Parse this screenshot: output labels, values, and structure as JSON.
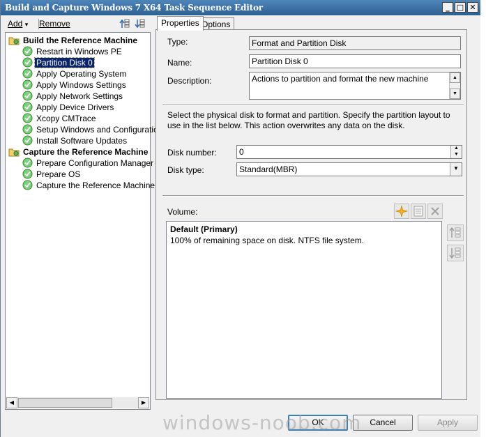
{
  "window": {
    "title": "Build and Capture Windows 7 X64 Task Sequence Editor"
  },
  "window_controls": {
    "minimize": "_",
    "maximize": "□",
    "close": "✕"
  },
  "toolbar": {
    "add_label": "Add",
    "add_caret": "▾",
    "remove_label": "Remove"
  },
  "tree": {
    "groups": [
      {
        "label": "Build the Reference Machine",
        "items": [
          "Restart in Windows PE",
          "Partition Disk 0",
          "Apply Operating System",
          "Apply Windows Settings",
          "Apply Network Settings",
          "Apply Device Drivers",
          "Xcopy CMTrace",
          "Setup Windows and Configuration",
          "Install Software Updates"
        ]
      },
      {
        "label": "Capture the Reference Machine",
        "items": [
          "Prepare Configuration Manager Cli",
          "Prepare OS",
          "Capture the Reference Machine"
        ]
      }
    ],
    "selected_item": "Partition Disk 0"
  },
  "tabs": {
    "properties": "Properties",
    "options": "Options"
  },
  "properties": {
    "type_label": "Type:",
    "type_value": "Format and Partition Disk",
    "name_label": "Name:",
    "name_value": "Partition Disk 0",
    "description_label": "Description:",
    "description_value": "Actions to partition and format the new machine",
    "info_text": "Select the physical disk to format and partition. Specify the partition layout to use in the list below. This action overwrites any data on the disk.",
    "disk_number_label": "Disk number:",
    "disk_number_value": "0",
    "disk_type_label": "Disk type:",
    "disk_type_value": "Standard(MBR)",
    "volume_label": "Volume:",
    "volumes": [
      {
        "name": "Default (Primary)",
        "detail": "100% of remaining space on disk. NTFS file system."
      }
    ]
  },
  "buttons": {
    "ok": "OK",
    "cancel": "Cancel",
    "apply": "Apply"
  },
  "watermark": "windows-noob.com",
  "colors": {
    "title_bar": "#2d5f92",
    "selection": "#0a246a",
    "check_green": "#2e9b2e"
  }
}
